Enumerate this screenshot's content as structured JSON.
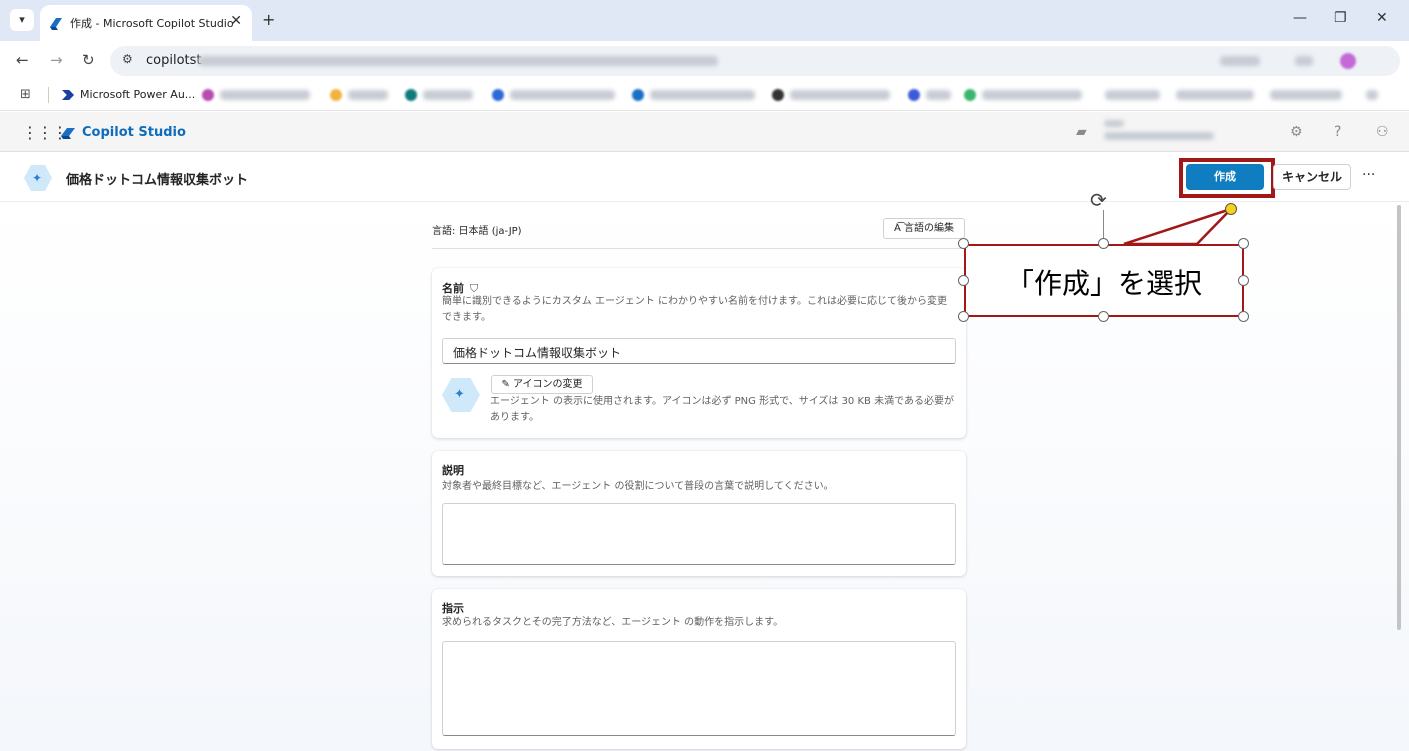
{
  "browser": {
    "tab_title": "作成 - Microsoft Copilot Studio",
    "url": "copilotst",
    "bookmark_1": "Microsoft Power Au..."
  },
  "app": {
    "name": "Copilot Studio"
  },
  "page": {
    "title": "価格ドットコム情報収集ボット",
    "create_label": "作成",
    "cancel_label": "キャンセル",
    "more_label": "···"
  },
  "language": {
    "label": "言語: 日本語 (ja-JP)",
    "edit_label": "言語の編集"
  },
  "name_card": {
    "heading": "名前",
    "description": "簡単に識別できるようにカスタム エージェント にわかりやすい名前を付けます。これは必要に応じて後から変更できます。",
    "value": "価格ドットコム情報収集ボット",
    "icon_button": "アイコンの変更",
    "icon_note": "エージェント の表示に使用されます。アイコンは必ず PNG 形式で、サイズは 30 KB 未満である必要があります。"
  },
  "description_card": {
    "heading": "説明",
    "description": "対象者や最終目標など、エージェント の役割について普段の言葉で説明してください。",
    "value": ""
  },
  "instructions_card": {
    "heading": "指示",
    "description": "求められるタスクとその完了方法など、エージェント の動作を指示します。",
    "value": ""
  },
  "annotation": {
    "text": "「作成」を選択"
  },
  "colors": {
    "accent": "#0f7dbf",
    "callout_border": "#a01818"
  }
}
